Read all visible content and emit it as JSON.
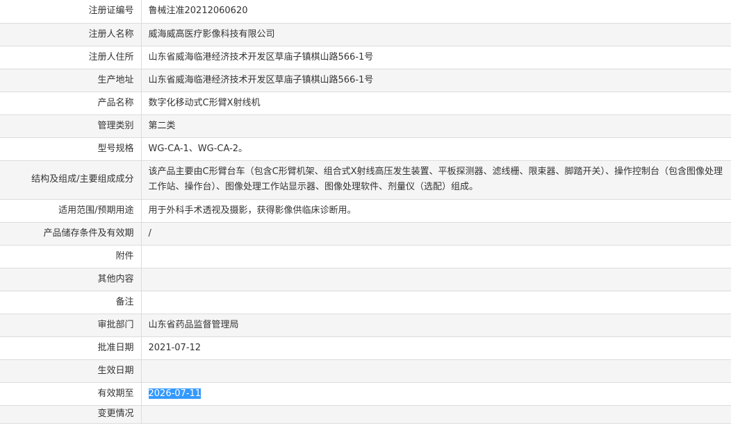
{
  "record": {
    "rows": [
      {
        "label": "注册证编号",
        "value": "鲁械注准20212060620"
      },
      {
        "label": "注册人名称",
        "value": "威海威高医疗影像科技有限公司"
      },
      {
        "label": "注册人住所",
        "value": "山东省威海临港经济技术开发区草庙子镇棋山路566-1号"
      },
      {
        "label": "生产地址",
        "value": "山东省威海临港经济技术开发区草庙子镇棋山路566-1号"
      },
      {
        "label": "产品名称",
        "value": "数字化移动式C形臂X射线机"
      },
      {
        "label": "管理类别",
        "value": "第二类"
      },
      {
        "label": "型号规格",
        "value": "WG-CA-1、WG-CA-2。"
      },
      {
        "label": "结构及组成/主要组成成分",
        "value": "该产品主要由C形臂台车（包含C形臂机架、组合式X射线高压发生装置、平板探测器、滤线栅、限束器、脚踏开关）、操作控制台（包含图像处理工作站、操作台）、图像处理工作站显示器、图像处理软件、剂量仪（选配）组成。"
      },
      {
        "label": "适用范围/预期用途",
        "value": "用于外科手术透视及摄影，获得影像供临床诊断用。"
      },
      {
        "label": "产品储存条件及有效期",
        "value": "/"
      },
      {
        "label": "附件",
        "value": ""
      },
      {
        "label": "其他内容",
        "value": ""
      },
      {
        "label": "备注",
        "value": ""
      },
      {
        "label": "审批部门",
        "value": "山东省药品监督管理局"
      },
      {
        "label": "批准日期",
        "value": "2021-07-12"
      },
      {
        "label": "生效日期",
        "value": ""
      },
      {
        "label": "有效期至",
        "value": "2026-07-11"
      },
      {
        "label": "变更情况",
        "value": ""
      }
    ]
  },
  "colors": {
    "selection": "#3399ff",
    "row_alt": "#f5f5f5",
    "border": "#dcdcdc"
  }
}
